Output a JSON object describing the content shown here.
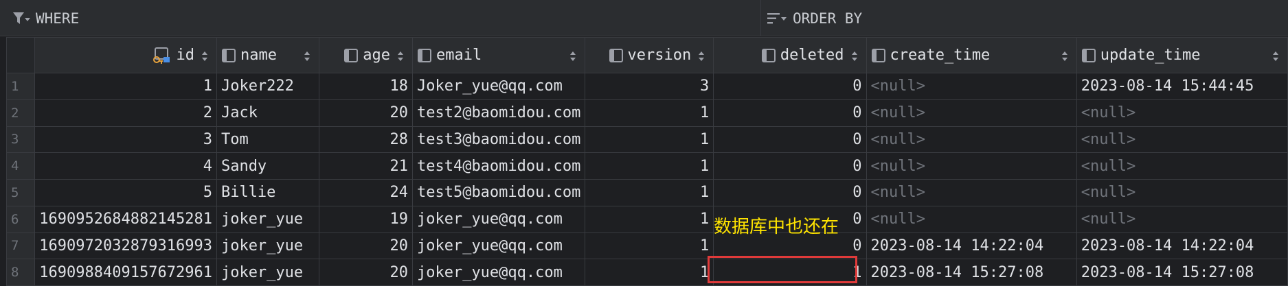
{
  "filter_bar": {
    "where_label": "WHERE",
    "order_by_label": "ORDER BY"
  },
  "columns": [
    "id",
    "name",
    "age",
    "email",
    "version",
    "deleted",
    "create_time",
    "update_time"
  ],
  "rows": [
    {
      "n": "1",
      "id": "1",
      "name": "Joker222",
      "age": "18",
      "email": "Joker_yue@qq.com",
      "version": "3",
      "deleted": "0",
      "create_time": "<null>",
      "update_time": "2023-08-14 15:44:45"
    },
    {
      "n": "2",
      "id": "2",
      "name": "Jack",
      "age": "20",
      "email": "test2@baomidou.com",
      "version": "1",
      "deleted": "0",
      "create_time": "<null>",
      "update_time": "<null>"
    },
    {
      "n": "3",
      "id": "3",
      "name": "Tom",
      "age": "28",
      "email": "test3@baomidou.com",
      "version": "1",
      "deleted": "0",
      "create_time": "<null>",
      "update_time": "<null>"
    },
    {
      "n": "4",
      "id": "4",
      "name": "Sandy",
      "age": "21",
      "email": "test4@baomidou.com",
      "version": "1",
      "deleted": "0",
      "create_time": "<null>",
      "update_time": "<null>"
    },
    {
      "n": "5",
      "id": "5",
      "name": "Billie",
      "age": "24",
      "email": "test5@baomidou.com",
      "version": "1",
      "deleted": "0",
      "create_time": "<null>",
      "update_time": "<null>"
    },
    {
      "n": "6",
      "id": "1690952684882145281",
      "name": "joker_yue",
      "age": "19",
      "email": "joker_yue@qq.com",
      "version": "1",
      "deleted": "0",
      "create_time": "<null>",
      "update_time": "<null>"
    },
    {
      "n": "7",
      "id": "1690972032879316993",
      "name": "joker_yue",
      "age": "20",
      "email": "joker_yue@qq.com",
      "version": "1",
      "deleted": "0",
      "create_time": "2023-08-14 14:22:04",
      "update_time": "2023-08-14 14:22:04"
    },
    {
      "n": "8",
      "id": "1690988409157672961",
      "name": "joker_yue",
      "age": "20",
      "email": "joker_yue@qq.com",
      "version": "1",
      "deleted": "1",
      "create_time": "2023-08-14 15:27:08",
      "update_time": "2023-08-14 15:27:08"
    }
  ],
  "annotation": {
    "text": "数据库中也还在",
    "color": "#ffe400",
    "highlight_color": "#e03a3a"
  },
  "icons": {
    "filter": "filter-icon",
    "sort": "sort-lines-icon",
    "column": "column-icon",
    "key": "primary-key-icon",
    "sort_toggle": "sort-toggle-icon"
  }
}
